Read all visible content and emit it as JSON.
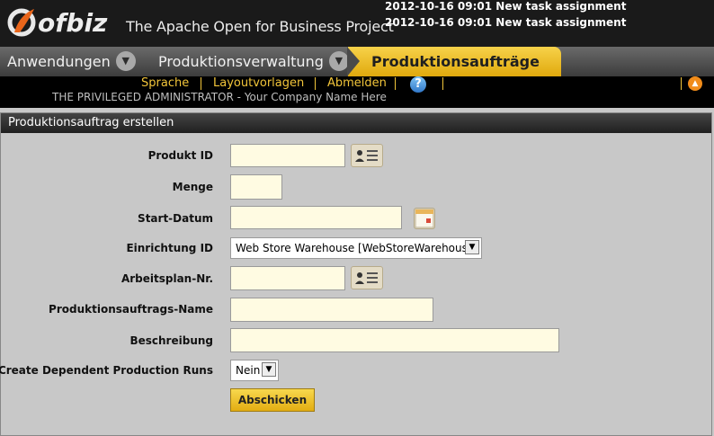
{
  "header": {
    "logo_text": "ofbiz",
    "tagline": "The Apache Open for Business Project",
    "notifications": [
      "2012-10-16 09:01 New task assignment",
      "2012-10-16 09:01 New task assignment"
    ]
  },
  "tabs": [
    {
      "label": "Anwendungen",
      "icon": "chevron-down-icon"
    },
    {
      "label": "Produktionsverwaltung",
      "icon": "chevron-down-icon"
    },
    {
      "label": "Produktionsaufträge",
      "active": true
    }
  ],
  "subnav": {
    "links": [
      "Sprache",
      "Layoutvorlagen",
      "Abmelden"
    ],
    "help_icon": "help-icon",
    "help_label": "?",
    "user_text": "THE PRIVILEGED ADMINISTRATOR - Your Company Name Here",
    "collapse_icon": "chevron-up-icon"
  },
  "form": {
    "title": "Produktionsauftrag erstellen",
    "fields": {
      "produkt_id": {
        "label": "Produkt ID",
        "value": ""
      },
      "menge": {
        "label": "Menge",
        "value": ""
      },
      "start_datum": {
        "label": "Start-Datum",
        "value": ""
      },
      "einrichtung_id": {
        "label": "Einrichtung ID",
        "value": "Web Store Warehouse [WebStoreWarehouse]"
      },
      "arbeitsplan_nr": {
        "label": "Arbeitsplan-Nr.",
        "value": ""
      },
      "produktionsauftrags_name": {
        "label": "Produktionsauftrags-Name",
        "value": ""
      },
      "beschreibung": {
        "label": "Beschreibung",
        "value": ""
      },
      "create_dependent": {
        "label": "Create Dependent Production Runs",
        "value": "Nein"
      }
    },
    "submit_label": "Abschicken"
  },
  "colors": {
    "accent": "#f2c53a",
    "active_tab": "#e9b924",
    "input_bg": "#fffbe2"
  }
}
